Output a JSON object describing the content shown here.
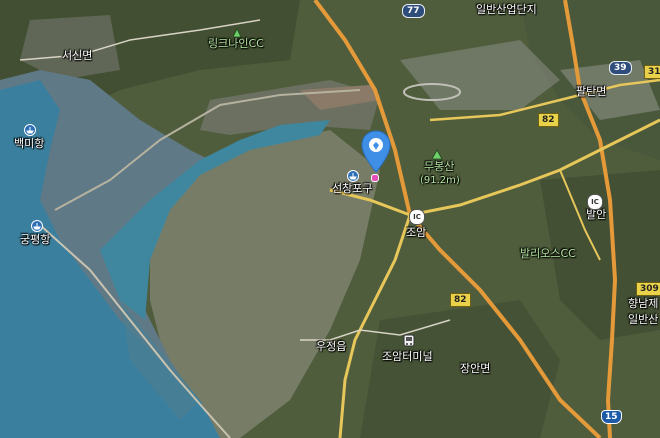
{
  "map": {
    "place_labels": [
      {
        "id": "seosin",
        "text": "서신면"
      },
      {
        "id": "link",
        "text": "링크나인CC"
      },
      {
        "id": "baekmi",
        "text": "백미항"
      },
      {
        "id": "gungpyeong",
        "text": "궁평항"
      },
      {
        "id": "seonchang",
        "text": "선창포구"
      },
      {
        "id": "mubong",
        "text": "무봉산"
      },
      {
        "id": "mubong_elev",
        "text": "(91.2m)"
      },
      {
        "id": "joam",
        "text": "조암"
      },
      {
        "id": "ujeong",
        "text": "우정읍"
      },
      {
        "id": "joam_terminal",
        "text": "조암터미널"
      },
      {
        "id": "jangan",
        "text": "장안면"
      },
      {
        "id": "paltan",
        "text": "팔탄면"
      },
      {
        "id": "balan",
        "text": "발안"
      },
      {
        "id": "balio",
        "text": "발리오스CC"
      },
      {
        "id": "ilban_top",
        "text": "일반산업단지"
      },
      {
        "id": "hyangnam",
        "text": "향남제"
      },
      {
        "id": "ilban_right",
        "text": "일반산"
      }
    ],
    "road_shields": [
      {
        "id": "r77",
        "text": "77"
      },
      {
        "id": "r82a",
        "text": "82"
      },
      {
        "id": "r82b",
        "text": "82"
      },
      {
        "id": "r39",
        "text": "39"
      },
      {
        "id": "r31",
        "text": "31"
      },
      {
        "id": "r309",
        "text": "309"
      },
      {
        "id": "r15",
        "text": "15"
      }
    ],
    "ic_label": "IC",
    "icons": [
      "location-pin-icon",
      "port-icon",
      "mountain-icon",
      "bus-terminal-icon",
      "interchange-icon"
    ],
    "colors": {
      "sea": "#3b7f9e",
      "mudflat": "#5f7a86",
      "land": "#51603e",
      "road_orange": "#e59a3a",
      "road_yellow": "#e7c65a",
      "pin": "#3f8fe6"
    }
  }
}
